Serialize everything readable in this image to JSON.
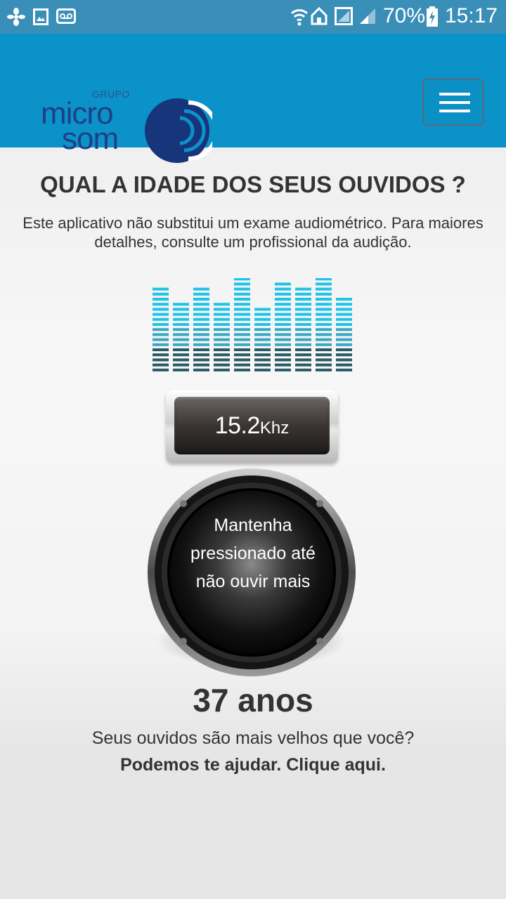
{
  "status_bar": {
    "battery": "70%",
    "time": "15:17",
    "icons": [
      "fan-icon",
      "gallery-icon",
      "voicemail-icon",
      "wifi-icon",
      "home-icon",
      "signal-empty-icon",
      "signal-icon",
      "battery-charging-icon"
    ]
  },
  "header": {
    "logo": {
      "grupo": "GRUPO",
      "line1": "micro",
      "line2": "som"
    },
    "menu_icon": "hamburger-icon",
    "brand_color": "#0b93c9"
  },
  "main": {
    "title": "QUAL A IDADE DOS SEUS OUVIDOS ?",
    "disclaimer": "Este aplicativo não substitui um exame audiométrico. Para maiores detalhes, consulte um profissional da audição.",
    "frequency_value": "15.2",
    "frequency_unit": "Khz",
    "press_instruction": "Mantenha pressionado até não ouvir mais",
    "age_result": "37 anos",
    "age_question": "Seus ouvidos são mais velhos que você?",
    "help_link": "Podemos te ajudar. Clique aqui."
  },
  "equalizer": {
    "accent": "#1fc3e8",
    "levels": [
      0.87,
      0.75,
      0.9,
      0.75,
      1.0,
      0.7,
      0.95,
      0.88,
      1.0,
      0.78
    ]
  }
}
